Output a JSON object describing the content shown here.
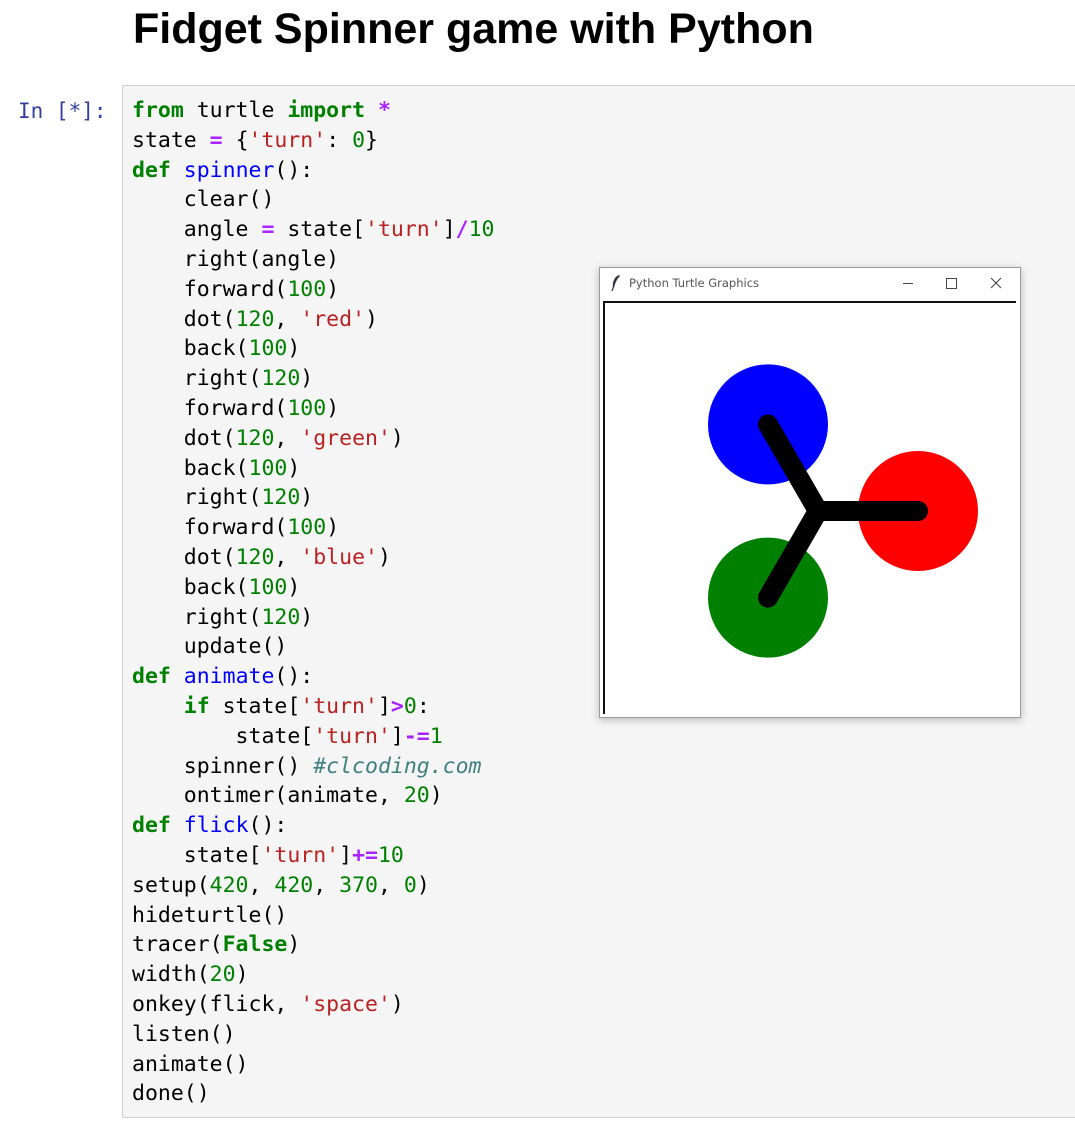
{
  "page": {
    "title": "Fidget Spinner game with Python"
  },
  "cell": {
    "prompt": "In [*]:",
    "lines": [
      [
        [
          "kw",
          "from"
        ],
        [
          "t",
          " turtle "
        ],
        [
          "kw",
          "import"
        ],
        [
          "t",
          " "
        ],
        [
          "op",
          "*"
        ]
      ],
      [
        [
          "t",
          "state "
        ],
        [
          "op",
          "="
        ],
        [
          "t",
          " {"
        ],
        [
          "str",
          "'turn'"
        ],
        [
          "t",
          ": "
        ],
        [
          "num",
          "0"
        ],
        [
          "t",
          "}"
        ]
      ],
      [
        [
          "kw",
          "def"
        ],
        [
          "t",
          " "
        ],
        [
          "fn",
          "spinner"
        ],
        [
          "t",
          "():"
        ]
      ],
      [
        [
          "t",
          "    clear()"
        ]
      ],
      [
        [
          "t",
          "    angle "
        ],
        [
          "op",
          "="
        ],
        [
          "t",
          " state["
        ],
        [
          "str",
          "'turn'"
        ],
        [
          "t",
          "]"
        ],
        [
          "op",
          "/"
        ],
        [
          "num",
          "10"
        ]
      ],
      [
        [
          "t",
          "    right(angle)"
        ]
      ],
      [
        [
          "t",
          "    forward("
        ],
        [
          "num",
          "100"
        ],
        [
          "t",
          ")"
        ]
      ],
      [
        [
          "t",
          "    dot("
        ],
        [
          "num",
          "120"
        ],
        [
          "t",
          ", "
        ],
        [
          "str",
          "'red'"
        ],
        [
          "t",
          ")"
        ]
      ],
      [
        [
          "t",
          "    back("
        ],
        [
          "num",
          "100"
        ],
        [
          "t",
          ")"
        ]
      ],
      [
        [
          "t",
          "    right("
        ],
        [
          "num",
          "120"
        ],
        [
          "t",
          ")"
        ]
      ],
      [
        [
          "t",
          "    forward("
        ],
        [
          "num",
          "100"
        ],
        [
          "t",
          ")"
        ]
      ],
      [
        [
          "t",
          "    dot("
        ],
        [
          "num",
          "120"
        ],
        [
          "t",
          ", "
        ],
        [
          "str",
          "'green'"
        ],
        [
          "t",
          ")"
        ]
      ],
      [
        [
          "t",
          "    back("
        ],
        [
          "num",
          "100"
        ],
        [
          "t",
          ")"
        ]
      ],
      [
        [
          "t",
          "    right("
        ],
        [
          "num",
          "120"
        ],
        [
          "t",
          ")"
        ]
      ],
      [
        [
          "t",
          "    forward("
        ],
        [
          "num",
          "100"
        ],
        [
          "t",
          ")"
        ]
      ],
      [
        [
          "t",
          "    dot("
        ],
        [
          "num",
          "120"
        ],
        [
          "t",
          ", "
        ],
        [
          "str",
          "'blue'"
        ],
        [
          "t",
          ")"
        ]
      ],
      [
        [
          "t",
          "    back("
        ],
        [
          "num",
          "100"
        ],
        [
          "t",
          ")"
        ]
      ],
      [
        [
          "t",
          "    right("
        ],
        [
          "num",
          "120"
        ],
        [
          "t",
          ")"
        ]
      ],
      [
        [
          "t",
          "    update()"
        ]
      ],
      [
        [
          "kw",
          "def"
        ],
        [
          "t",
          " "
        ],
        [
          "fn",
          "animate"
        ],
        [
          "t",
          "():"
        ]
      ],
      [
        [
          "t",
          "    "
        ],
        [
          "kw",
          "if"
        ],
        [
          "t",
          " state["
        ],
        [
          "str",
          "'turn'"
        ],
        [
          "t",
          "]"
        ],
        [
          "op",
          ">"
        ],
        [
          "num",
          "0"
        ],
        [
          "t",
          ":"
        ]
      ],
      [
        [
          "t",
          "        state["
        ],
        [
          "str",
          "'turn'"
        ],
        [
          "t",
          "]"
        ],
        [
          "op",
          "-="
        ],
        [
          "num",
          "1"
        ]
      ],
      [
        [
          "t",
          "    spinner() "
        ],
        [
          "cm",
          "#clcoding.com"
        ]
      ],
      [
        [
          "t",
          "    ontimer(animate, "
        ],
        [
          "num",
          "20"
        ],
        [
          "t",
          ")"
        ]
      ],
      [
        [
          "kw",
          "def"
        ],
        [
          "t",
          " "
        ],
        [
          "fn",
          "flick"
        ],
        [
          "t",
          "():"
        ]
      ],
      [
        [
          "t",
          "    state["
        ],
        [
          "str",
          "'turn'"
        ],
        [
          "t",
          "]"
        ],
        [
          "op",
          "+="
        ],
        [
          "num",
          "10"
        ]
      ],
      [
        [
          "t",
          "setup("
        ],
        [
          "num",
          "420"
        ],
        [
          "t",
          ", "
        ],
        [
          "num",
          "420"
        ],
        [
          "t",
          ", "
        ],
        [
          "num",
          "370"
        ],
        [
          "t",
          ", "
        ],
        [
          "num",
          "0"
        ],
        [
          "t",
          ")"
        ]
      ],
      [
        [
          "t",
          "hideturtle()"
        ]
      ],
      [
        [
          "t",
          "tracer("
        ],
        [
          "kw",
          "False"
        ],
        [
          "t",
          ")"
        ]
      ],
      [
        [
          "t",
          "width("
        ],
        [
          "num",
          "20"
        ],
        [
          "t",
          ")"
        ]
      ],
      [
        [
          "t",
          "onkey(flick, "
        ],
        [
          "str",
          "'space'"
        ],
        [
          "t",
          ")"
        ]
      ],
      [
        [
          "t",
          "listen()"
        ]
      ],
      [
        [
          "t",
          "animate()"
        ]
      ],
      [
        [
          "t",
          "done()"
        ]
      ]
    ]
  },
  "turtle_window": {
    "title": "Python Turtle Graphics",
    "app_icon": "feather-icon",
    "controls": [
      "minimize-icon",
      "maximize-icon",
      "close-icon"
    ],
    "spinner": {
      "heading_deg": 0,
      "arm_length": 100,
      "dot_diameter": 120,
      "pen_width": 20,
      "dots": [
        {
          "color": "red",
          "fill": "#ff0000",
          "angle_deg": 0
        },
        {
          "color": "green",
          "fill": "#008000",
          "angle_deg": -120
        },
        {
          "color": "blue",
          "fill": "#0000ff",
          "angle_deg": -240
        }
      ],
      "arm_color": "#000000"
    }
  }
}
